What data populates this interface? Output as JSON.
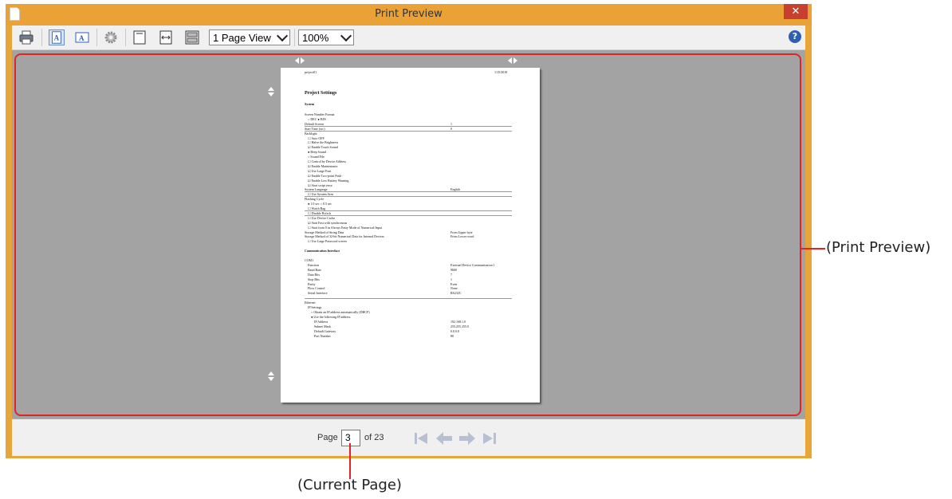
{
  "window": {
    "title": "Print Preview",
    "close_label": "✕"
  },
  "toolbar": {
    "view_select": "1 Page View",
    "zoom_select": "100%",
    "help_label": "?",
    "icons": [
      "print-icon",
      "portrait-icon",
      "landscape-icon",
      "settings-icon",
      "fit-page-icon",
      "fit-width-icon",
      "multipage-icon"
    ]
  },
  "document": {
    "header_left": "project01",
    "header_right": "1/15/2018",
    "title": "Project Settings",
    "section": "System",
    "lines": [
      {
        "label": "Screen Number Format",
        "value": ""
      },
      {
        "label": "○ DEC   ● BIN",
        "value": ""
      },
      {
        "label": "Default Screen",
        "value": "1"
      },
      {
        "label": "Start Time (sec)",
        "value": "0"
      },
      {
        "label": "Backlight",
        "value": ""
      },
      {
        "label": "☐ Auto OFF",
        "value": ""
      },
      {
        "label": "☐ Halve the Brightness",
        "value": ""
      },
      {
        "label": "☑ Enable Touch Sound",
        "value": ""
      },
      {
        "label": "● Beep Sound",
        "value": ""
      },
      {
        "label": "○ Sound File",
        "value": ""
      },
      {
        "label": "☐ Control by Device Address",
        "value": ""
      },
      {
        "label": "☑ Enable Maintenance",
        "value": ""
      },
      {
        "label": "☑ Use Large Font",
        "value": ""
      },
      {
        "label": "☑ Enable Two-point Push",
        "value": ""
      },
      {
        "label": "☑ Enable Low Battery Warning",
        "value": ""
      },
      {
        "label": "☑ Start script error",
        "value": ""
      },
      {
        "label": "System Language",
        "value": "English"
      },
      {
        "label": "☐ Use System Area",
        "value": ""
      },
      {
        "label": "Flashing Cycle",
        "value": ""
      },
      {
        "label": "● 1.0 sec   ○ 0.5 sec",
        "value": ""
      },
      {
        "label": "☐ Watch Bag",
        "value": ""
      },
      {
        "label": "☐ Disable Bit/sch",
        "value": ""
      },
      {
        "label": "☐ Use Device Cache",
        "value": ""
      },
      {
        "label": "☑ Start Fast with synchronous",
        "value": ""
      },
      {
        "label": "☐ Start from 0 in Always Entry Mode of Numerical Input",
        "value": ""
      },
      {
        "label": "Storage Method of String Data",
        "value": "From Upper byte"
      },
      {
        "label": "Storage Method of 32-bit Numerical Data for Internal Devices",
        "value": "From Lower word"
      },
      {
        "label": "☐ Use Large Password screen",
        "value": ""
      }
    ],
    "section2": "Communication Interface",
    "com_label": "COM1",
    "com_lines": [
      {
        "label": "Function",
        "value": "External Device Communication 1"
      },
      {
        "label": "Baud Rate",
        "value": "9600"
      },
      {
        "label": "Data Bits",
        "value": "7"
      },
      {
        "label": "Stop Bits",
        "value": "1"
      },
      {
        "label": "Parity",
        "value": "Even"
      },
      {
        "label": "Flow Control",
        "value": "None"
      },
      {
        "label": "Serial Interface",
        "value": "RS232C"
      }
    ],
    "eth_label": "Ethernet",
    "eth_lines": [
      {
        "label": "IP Settings",
        "value": ""
      },
      {
        "label": "○ Obtain an IP address automatically (DHCP)",
        "value": ""
      },
      {
        "label": "● Use the following IP address",
        "value": ""
      },
      {
        "label": "IP Address",
        "value": "192.168.1.0"
      },
      {
        "label": "Subnet Mask",
        "value": "255.255.255.0"
      },
      {
        "label": "Default Gateway",
        "value": "0.0.0.0"
      },
      {
        "label": "Port Number",
        "value": "80"
      }
    ]
  },
  "pager": {
    "page_label": "Page",
    "current_page": "3",
    "of_label": "of 23"
  },
  "annotations": {
    "preview": "(Print Preview)",
    "current_page": "(Current Page)"
  }
}
